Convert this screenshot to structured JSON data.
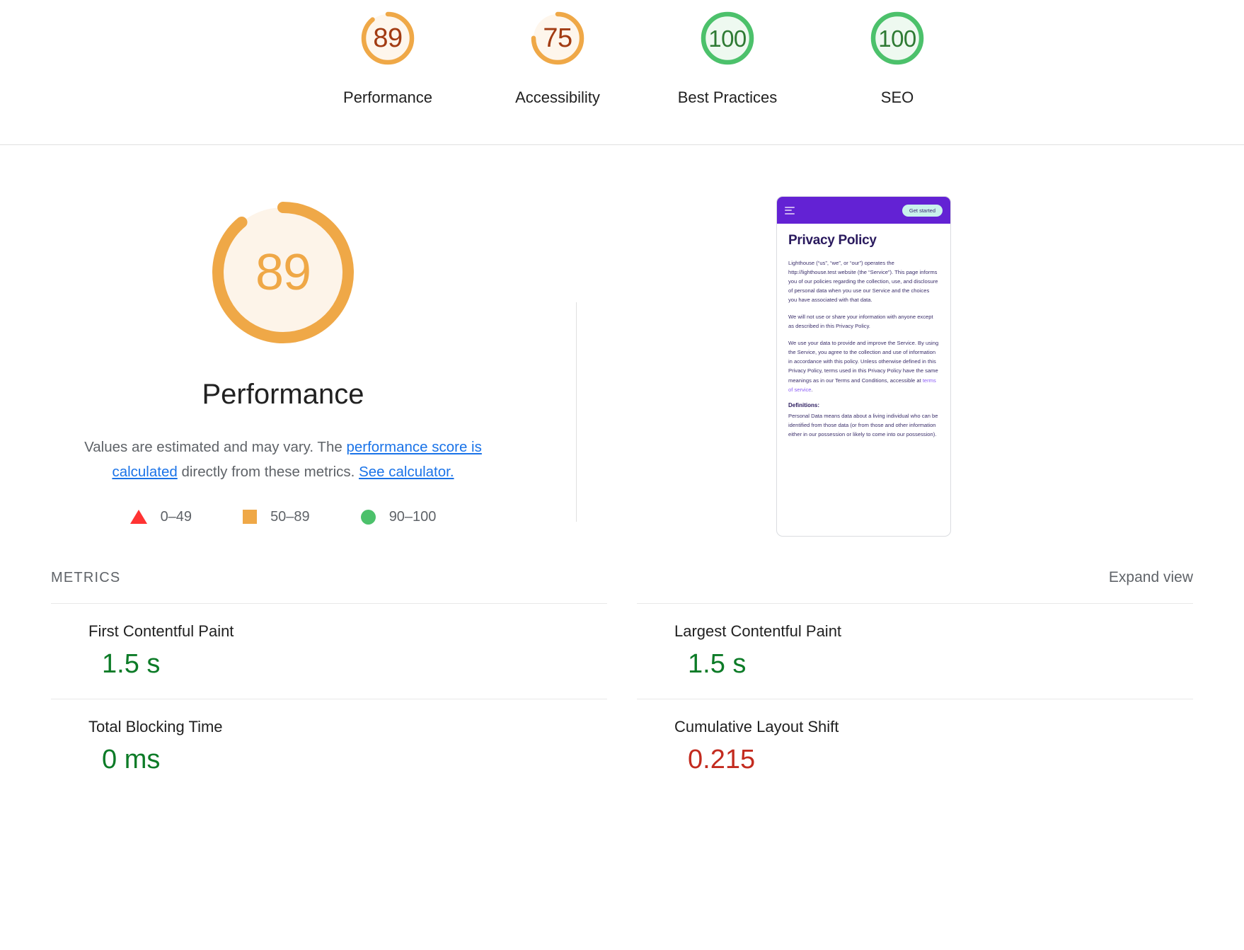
{
  "top_scores": [
    {
      "name": "score-performance",
      "value": "89",
      "label": "Performance",
      "color": "#EFA847",
      "num_color": "#A23B12",
      "fill": "#FEF6EC",
      "pct": 89
    },
    {
      "name": "score-accessibility",
      "value": "75",
      "label": "Accessibility",
      "color": "#EFA847",
      "num_color": "#A23B12",
      "fill": "#FEF6EC",
      "pct": 75
    },
    {
      "name": "score-best-practices",
      "value": "100",
      "label": "Best Practices",
      "color": "#4CC16B",
      "num_color": "#2E7A33",
      "fill": "#EEF9F0",
      "pct": 100
    },
    {
      "name": "score-seo",
      "value": "100",
      "label": "SEO",
      "color": "#4CC16B",
      "num_color": "#2E7A33",
      "fill": "#EEF9F0",
      "pct": 100
    }
  ],
  "performance": {
    "score": "89",
    "title": "Performance",
    "desc_before": "Values are estimated and may vary. The ",
    "link_calc_text": "performance score is calculated",
    "desc_middle": " directly from these metrics. ",
    "link_see_text": "See calculator.",
    "gauge_color": "#EFA847",
    "gauge_fill": "#FDF4E9",
    "pct": 89
  },
  "legend": [
    {
      "shape": "triangle",
      "label": "0–49",
      "color": "#FF3333"
    },
    {
      "shape": "square",
      "label": "50–89",
      "color": "#EFA847"
    },
    {
      "shape": "circle",
      "label": "90–100",
      "color": "#4CC16B"
    }
  ],
  "metrics_header": {
    "title": "METRICS",
    "expand_label": "Expand view"
  },
  "metrics": [
    {
      "name": "First Contentful Paint",
      "value": "1.5 s",
      "indicator": "circle",
      "value_class": "v-green"
    },
    {
      "name": "Largest Contentful Paint",
      "value": "1.5 s",
      "indicator": "circle",
      "value_class": "v-green"
    },
    {
      "name": "Total Blocking Time",
      "value": "0 ms",
      "indicator": "circle",
      "value_class": "v-green"
    },
    {
      "name": "Cumulative Layout Shift",
      "value": "0.215",
      "indicator": "square",
      "value_class": "v-red"
    }
  ],
  "thumbnail": {
    "menu_icon": "hamburger-icon",
    "cta_label": "Get started",
    "heading": "Privacy Policy",
    "paragraphs": [
      "Lighthouse (“us”, “we”, or “our”) operates the http://lighthouse.test website (the “Service”). This page informs you of our policies regarding the collection, use, and disclosure of personal data when you use our Service and the choices you have associated with that data.",
      "We will not use or share your information with anyone except as described in this Privacy Policy.",
      "We use your data to provide and improve the Service. By using the Service, you agree to the collection and use of information in accordance with this policy. Unless otherwise defined in this Privacy Policy, terms used in this Privacy Policy have the same meanings as in our Terms and Conditions, accessible at "
    ],
    "link_text": "terms of service",
    "definitions_heading": "Definitions:",
    "definitions_body": "Personal Data means data about a living individual who can be identified from those data (or from those and other information either in our possession or likely to come into our possession)."
  }
}
